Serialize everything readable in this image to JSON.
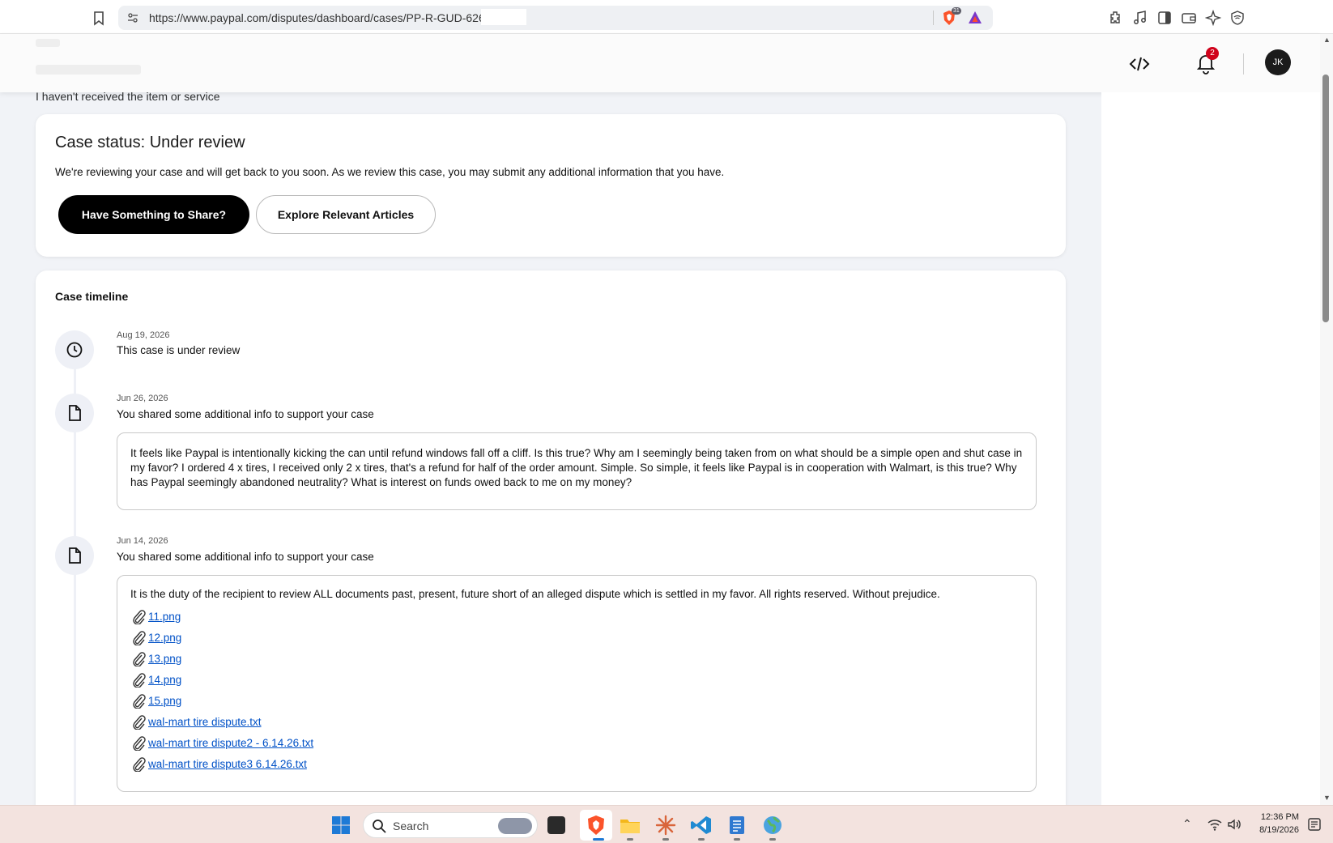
{
  "browser": {
    "url": "https://www.paypal.com/disputes/dashboard/cases/PP-R-GUD-626",
    "shield_count": "31"
  },
  "header": {
    "notification_count": "2",
    "avatar_initials": "JK"
  },
  "dispute_reason": "I haven't received the item or service",
  "status_card": {
    "title": "Case status: Under review",
    "description": "We're reviewing your case and will get back to you soon. As we review this case, you may submit any additional information that you have.",
    "share_button": "Have Something to Share?",
    "articles_button": "Explore Relevant Articles"
  },
  "timeline": {
    "title": "Case timeline",
    "events": [
      {
        "date": "Aug 19, 2026",
        "text": "This case is under review",
        "icon": "clock-icon"
      },
      {
        "date": "Jun 26, 2026",
        "text": "You shared some additional info to support your case",
        "icon": "document-icon",
        "message": "It feels like Paypal is intentionally kicking the can until refund windows fall off a cliff. Is this true? Why am I seemingly being taken from on what should be a simple open and shut case in my favor? I ordered 4 x tires, I received only 2 x tires, that's a refund for half of the order amount. Simple. So simple, it feels like Paypal is in cooperation with Walmart, is this true? Why has Paypal seemingly abandoned neutrality? What is interest on funds owed back to me on my money?"
      },
      {
        "date": "Jun 14, 2026",
        "text": "You shared some additional info to support your case",
        "icon": "document-icon",
        "message": "It is the duty of the recipient to review ALL documents past, present, future short of an alleged dispute which is settled in my favor. All rights reserved. Without prejudice.",
        "attachments": [
          "11.png",
          "12.png",
          "13.png",
          "14.png",
          "15.png",
          "wal-mart tire dispute.txt",
          "wal-mart tire dispute2 - 6.14.26.txt",
          "wal-mart tire dispute3 6.14.26.txt"
        ]
      }
    ]
  },
  "taskbar": {
    "search_label": "Search",
    "time": "12:36 PM",
    "date": "8/19/2026"
  },
  "colors": {
    "link": "#0051c7",
    "primary_button": "#000000",
    "badge": "#d0021b"
  }
}
